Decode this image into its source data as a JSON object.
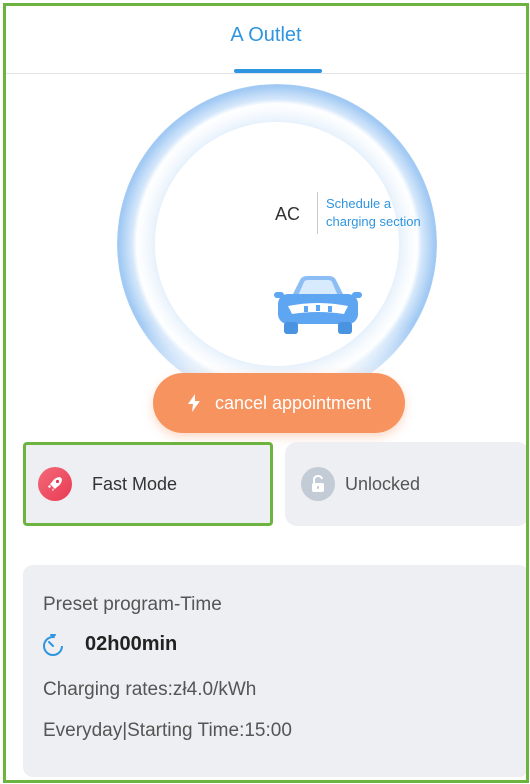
{
  "header": {
    "tab_label": "A Outlet"
  },
  "dial": {
    "current_type": "AC",
    "schedule_link": "Schedule a charging section",
    "icon": "car-icon"
  },
  "actions": {
    "cancel_label": "cancel appointment",
    "cancel_icon": "lightning-bolt-icon"
  },
  "modes": {
    "fast_label": "Fast Mode",
    "fast_icon": "rocket-icon",
    "lock_label": "Unlocked",
    "lock_icon": "unlocked-padlock-icon"
  },
  "preset": {
    "title": "Preset program-Time",
    "duration": "02h00min",
    "duration_icon": "timer-icon",
    "rate": "Charging rates:zł4.0/kWh",
    "schedule": "Everyday|Starting Time:15:00"
  },
  "colors": {
    "accent": "#2f95e0",
    "cancel_button": "#f7935f",
    "highlight_border": "#6db33f",
    "fast_mode_icon": "#e83a52",
    "card_background": "#eeeff2"
  }
}
